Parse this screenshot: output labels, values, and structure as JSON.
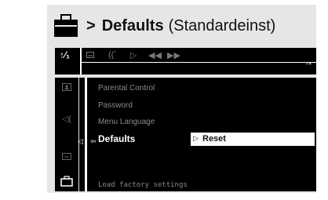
{
  "heading": {
    "arrow": ">",
    "title": "Defaults",
    "subtitle": "(Standardeinst)",
    "icon": "briefcase-icon"
  },
  "top_bar": {
    "icons": [
      "settings-tool-icon",
      "subtitle-icon",
      "audio-icon",
      "play-icon",
      "rewind-icon",
      "forward-icon"
    ],
    "active_icon": "settings-tool-icon",
    "active_glyph": "↑⁄₁"
  },
  "side_column": {
    "icons": [
      "picture-icon",
      "speaker-icon",
      "subtitle-icon",
      "briefcase-icon"
    ],
    "active_icon": "briefcase-icon"
  },
  "menu": {
    "items": [
      "Parental Control",
      "Password",
      "Menu Language",
      "Defaults"
    ],
    "selected_index": 3
  },
  "option": {
    "label": "Reset"
  },
  "footer": {
    "help": "Load factory settings"
  }
}
